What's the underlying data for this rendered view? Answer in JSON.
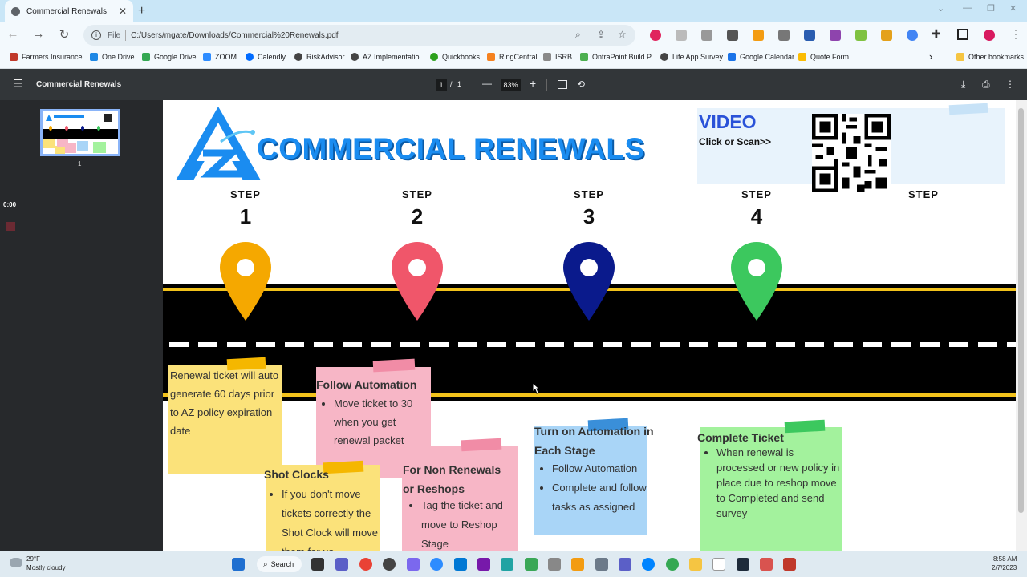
{
  "browser": {
    "tab_title": "Commercial Renewals",
    "tab_close": "✕",
    "new_tab": "+",
    "address_prefix": "File",
    "address": "C:/Users/mgate/Downloads/Commercial%20Renewals.pdf"
  },
  "bookmarks": [
    {
      "label": "Farmers Insurance...",
      "color": "#c0392b"
    },
    {
      "label": "One Drive",
      "color": "#1e88e5"
    },
    {
      "label": "Google Drive",
      "color": "#34a853"
    },
    {
      "label": "ZOOM",
      "color": "#2d8cff"
    },
    {
      "label": "Calendly",
      "color": "#006bff"
    },
    {
      "label": "RiskAdvisor",
      "color": "#444444"
    },
    {
      "label": "AZ Implementatio...",
      "color": "#444444"
    },
    {
      "label": "Quickbooks",
      "color": "#2ca01c"
    },
    {
      "label": "RingCentral",
      "color": "#f58220"
    },
    {
      "label": "ISRB",
      "color": "#8a8a8a"
    },
    {
      "label": "OntraPoint Build P...",
      "color": "#4caf50"
    },
    {
      "label": "Life App Survey",
      "color": "#444444"
    },
    {
      "label": "Google Calendar",
      "color": "#1a73e8"
    },
    {
      "label": "Quote Form",
      "color": "#fbbc04"
    }
  ],
  "bookmarks_more": "›",
  "other_bookmarks": "Other bookmarks",
  "pdf": {
    "title": "Commercial Renewals",
    "page_current": "1",
    "page_sep": "/",
    "page_total": "1",
    "zoom": "83%",
    "zoom_out": "—",
    "zoom_in": "+",
    "thumb_number": "1",
    "timer": "0:00"
  },
  "document": {
    "heading": "COMMERCIAL RENEWALS",
    "video_title": "VIDEO",
    "video_sub": "Click or Scan>>",
    "step_word": "STEP",
    "steps": [
      {
        "number": "1",
        "color": "#f5a800"
      },
      {
        "number": "2",
        "color": "#f0566a"
      },
      {
        "number": "3",
        "color": "#0a1a8c"
      },
      {
        "number": "4",
        "color": "#3cc85e"
      }
    ],
    "notes": {
      "step1": "Renewal ticket will auto generate 60 days prior to AZ policy expiration date",
      "shot_clocks_title": "Shot Clocks",
      "shot_clocks_item": "If you don't move tickets correctly the Shot Clock will move them for us",
      "follow_title": "Follow Automation",
      "follow_item": "Move ticket to 30 when you get renewal packet",
      "nonrenew_title": "For Non Renewals or Reshops",
      "nonrenew_item": "Tag the ticket and move to Reshop Stage",
      "automation_title": "Turn on Automation in Each Stage",
      "automation_items": [
        "Follow Automation",
        "Complete and follow tasks as assigned"
      ],
      "complete_title": "Complete Ticket",
      "complete_item": "When renewal is processed or new policy in place due to reshop move to Completed and send survey"
    }
  },
  "taskbar": {
    "weather_temp": "29°F",
    "weather_desc": "Mostly cloudy",
    "search": "Search",
    "time": "8:58 AM",
    "date": "2/7/2023"
  },
  "colors": {
    "yellow_note": "#fbe27a",
    "pink_note": "#f7b6c6",
    "blue_note": "#a9d5f7",
    "green_note": "#a3f29d",
    "heading_blue": "#1a8cf0"
  }
}
